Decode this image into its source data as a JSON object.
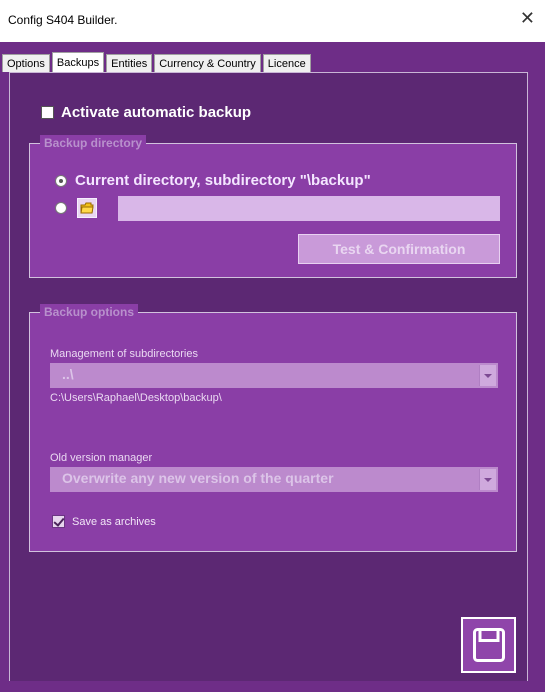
{
  "window": {
    "title": "Config S404 Builder.",
    "close_glyph": "✕"
  },
  "tabs": [
    {
      "label": "Options"
    },
    {
      "label": "Backups",
      "active": true
    },
    {
      "label": "Entities"
    },
    {
      "label": "Currency & Country"
    },
    {
      "label": "Licence"
    }
  ],
  "activate": {
    "label": "Activate automatic backup",
    "checked": false
  },
  "backup_directory": {
    "legend": "Backup directory",
    "option_current_label": "Current directory, subdirectory \"\\backup\"",
    "option_current_selected": true,
    "custom_path_value": "",
    "test_button_label": "Test & Confirmation"
  },
  "backup_options": {
    "legend": "Backup options",
    "subdirs_label": "Management of subdirectories",
    "subdirs_value": "..\\",
    "subdirs_path": "C:\\Users\\Raphael\\Desktop\\backup\\",
    "old_version_label": "Old version manager",
    "old_version_value": "Overwrite any new version of the quarter",
    "save_archives_label": "Save as archives",
    "save_archives_checked": true
  },
  "icons": {
    "close": "close-icon",
    "folder": "folder-icon",
    "save": "floppy-disk-icon",
    "dropdown": "chevron-down-icon"
  },
  "colors": {
    "frame": "#6e2d87",
    "panel": "#5c2873",
    "group_bg": "#8a3ea6",
    "disabled_text": "#b890cc"
  }
}
